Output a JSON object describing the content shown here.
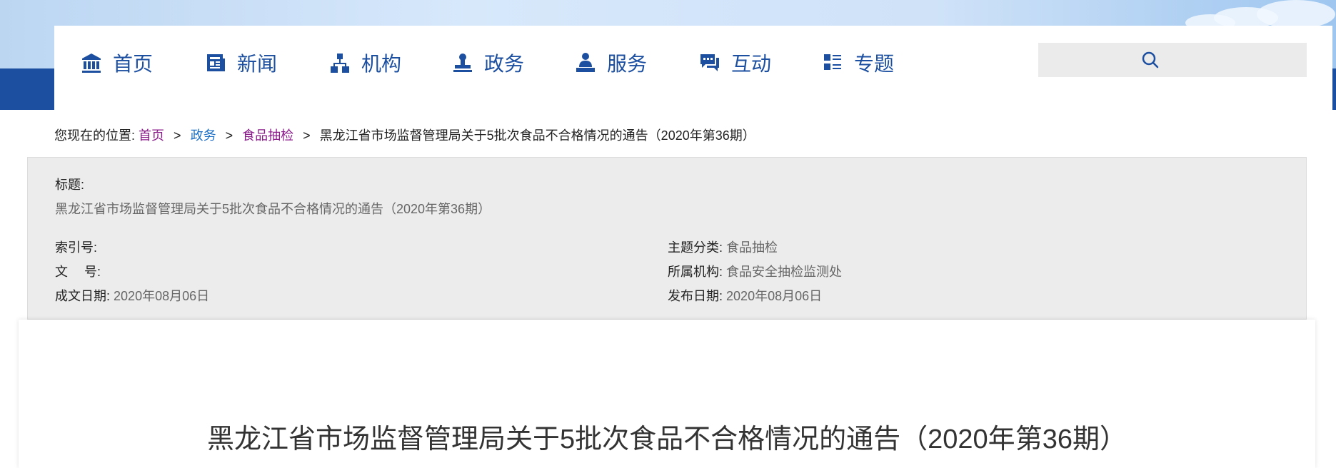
{
  "nav": {
    "items": [
      {
        "label": "首页",
        "icon": "bank-icon"
      },
      {
        "label": "新闻",
        "icon": "newspaper-icon"
      },
      {
        "label": "机构",
        "icon": "org-chart-icon"
      },
      {
        "label": "政务",
        "icon": "stamp-icon"
      },
      {
        "label": "服务",
        "icon": "service-user-icon"
      },
      {
        "label": "互动",
        "icon": "chat-icon"
      },
      {
        "label": "专题",
        "icon": "topic-list-icon"
      }
    ],
    "search": {
      "icon": "search-icon",
      "placeholder": ""
    }
  },
  "breadcrumb": {
    "prefix": "您现在的位置:",
    "links": [
      "首页",
      "政务",
      "食品抽检"
    ],
    "current": "黑龙江省市场监督管理局关于5批次食品不合格情况的通告（2020年第36期）",
    "separator": ">"
  },
  "meta": {
    "title_label": "标题:",
    "title_value": "黑龙江省市场监督管理局关于5批次食品不合格情况的通告（2020年第36期）",
    "index_label": "索引号:",
    "index_value": "",
    "docno_label": "文　 号:",
    "docno_value": "",
    "written_date_label": "成文日期:",
    "written_date_value": "2020年08月06日",
    "topic_label": "主题分类:",
    "topic_value": "食品抽检",
    "org_label": "所属机构:",
    "org_value": "食品安全抽检监测处",
    "publish_date_label": "发布日期:",
    "publish_date_value": "2020年08月06日"
  },
  "article": {
    "title": "黑龙江省市场监督管理局关于5批次食品不合格情况的通告（2020年第36期）"
  },
  "colors": {
    "brand_blue": "#1c4fa0",
    "link_purple": "#8b1a8b",
    "link_blue": "#1c6fc4",
    "meta_bg": "#ececec"
  }
}
